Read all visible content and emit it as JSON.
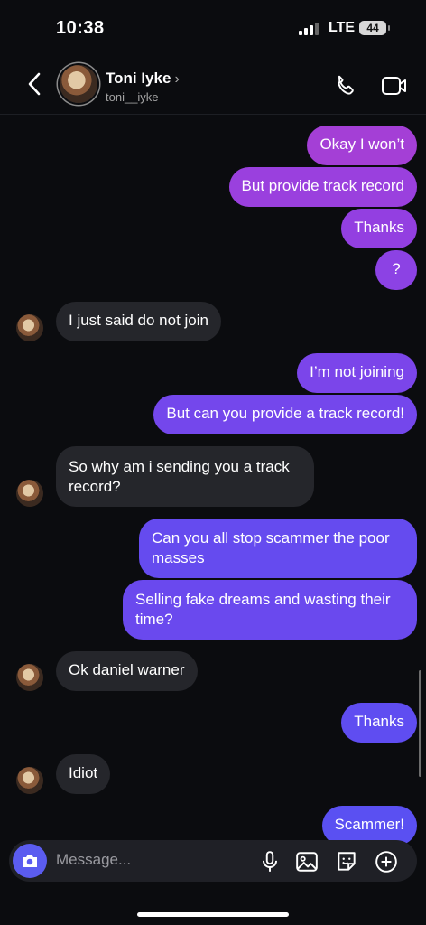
{
  "status_bar": {
    "time": "10:38",
    "network": "LTE",
    "battery": "44"
  },
  "header": {
    "name": "Toni Iyke",
    "chevron": "›",
    "username": "toni__iyke"
  },
  "messages": [
    {
      "side": "out",
      "text": "Okay I won’t",
      "color": "#a43fd6"
    },
    {
      "side": "out",
      "text": "But provide track record",
      "color": "#9a40de"
    },
    {
      "side": "out",
      "text": "Thanks",
      "color": "#933fe1"
    },
    {
      "side": "out",
      "text": "?",
      "color": "#8c42e4"
    },
    {
      "side": "in",
      "text": "I just said do not join"
    },
    {
      "side": "out",
      "text": "I’m not joining",
      "color": "#7b45ea"
    },
    {
      "side": "out",
      "text": "But can you provide a track record!",
      "color": "#7447ec"
    },
    {
      "side": "in",
      "text": "So why am i sending you a track record?"
    },
    {
      "side": "out",
      "text": "Can you all stop scammer the poor masses",
      "color": "#654bef"
    },
    {
      "side": "out",
      "text": "Selling fake dreams and wasting their time?",
      "color": "#6a49ee"
    },
    {
      "side": "in",
      "text": "Ok daniel warner"
    },
    {
      "side": "out",
      "text": "Thanks",
      "color": "#5f4df1"
    },
    {
      "side": "in",
      "text": "Idiot"
    },
    {
      "side": "out",
      "text": "Scammer!",
      "color": "#5a50f2"
    }
  ],
  "composer": {
    "placeholder": "Message..."
  },
  "icons": {
    "back": "chevron-left-icon",
    "call": "phone-icon",
    "video": "video-camera-icon",
    "camera": "camera-icon",
    "mic": "microphone-icon",
    "gallery": "image-icon",
    "sticker": "sticker-icon",
    "add": "plus-circle-icon"
  },
  "colors": {
    "background": "#0b0c0f",
    "incoming_bubble": "#25262b",
    "camera_button": "#5b5cf0"
  }
}
